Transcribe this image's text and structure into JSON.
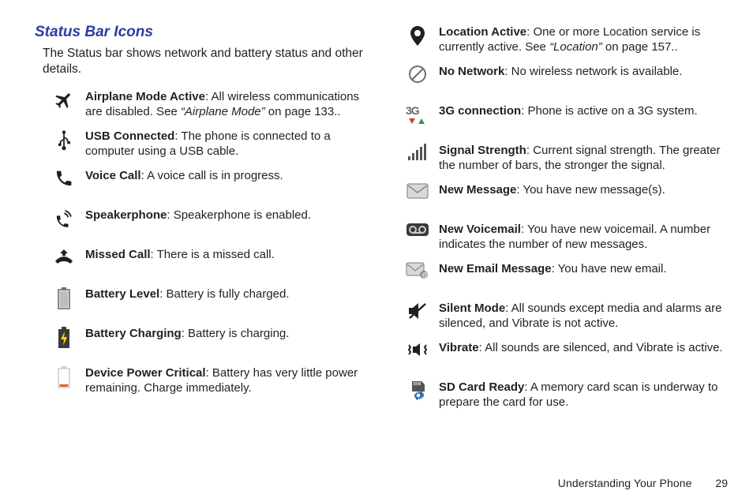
{
  "section_title": "Status Bar Icons",
  "intro": "The Status bar shows network and battery status and other details.",
  "left_items": [
    {
      "icon": "airplane",
      "title": "Airplane Mode Active",
      "text": ": All wireless communications are disabled. See ",
      "ref": "“Airplane Mode”",
      "after": " on page 133.."
    },
    {
      "icon": "usb",
      "title": "USB Connected",
      "text": ": The phone is connected to a computer using a USB cable.",
      "ref": "",
      "after": ""
    },
    {
      "icon": "phone",
      "title": "Voice Call",
      "text": ": A voice call is in progress.",
      "ref": "",
      "after": ""
    },
    {
      "icon": "speakerphone",
      "title": "Speakerphone",
      "text": ": Speakerphone is enabled.",
      "ref": "",
      "after": ""
    },
    {
      "icon": "missed",
      "title": "Missed Call",
      "text": ": There is a missed call.",
      "ref": "",
      "after": ""
    },
    {
      "icon": "battery-full",
      "title": "Battery Level",
      "text": ": Battery is fully charged.",
      "ref": "",
      "after": ""
    },
    {
      "icon": "battery-charge",
      "title": "Battery Charging",
      "text": ": Battery is charging.",
      "ref": "",
      "after": ""
    },
    {
      "icon": "battery-low",
      "title": "Device Power Critical",
      "text": ": Battery has very little power remaining. Charge immediately.",
      "ref": "",
      "after": ""
    }
  ],
  "right_items": [
    {
      "icon": "location",
      "title": "Location Active",
      "text": ": One or more Location service is currently active. See ",
      "ref": "“Location”",
      "after": " on page 157.."
    },
    {
      "icon": "nonet",
      "title": "No Network",
      "text": ": No wireless network is available.",
      "ref": "",
      "after": ""
    },
    {
      "icon": "3g",
      "title": "3G connection",
      "text": ": Phone is active on a 3G system.",
      "ref": "",
      "after": ""
    },
    {
      "icon": "signal",
      "title": "Signal Strength",
      "text": ": Current signal strength. The greater the number of bars, the stronger the signal.",
      "ref": "",
      "after": ""
    },
    {
      "icon": "message",
      "title": "New Message",
      "text": ": You have new message(s).",
      "ref": "",
      "after": ""
    },
    {
      "icon": "voicemail",
      "title": "New Voicemail",
      "text": ": You have new voicemail. A number indicates the number of new messages.",
      "ref": "",
      "after": ""
    },
    {
      "icon": "email",
      "title": "New Email Message",
      "text": ": You have new email.",
      "ref": "",
      "after": ""
    },
    {
      "icon": "silent",
      "title": "Silent Mode",
      "text": ": All sounds except media and alarms are silenced, and Vibrate is not active.",
      "ref": "",
      "after": ""
    },
    {
      "icon": "vibrate",
      "title": "Vibrate",
      "text": ": All sounds are silenced, and Vibrate is active.",
      "ref": "",
      "after": ""
    },
    {
      "icon": "sdcard",
      "title": "SD Card Ready",
      "text": ": A memory card scan is underway to prepare the card for use.",
      "ref": "",
      "after": ""
    }
  ],
  "footer_section": "Understanding Your Phone",
  "footer_page": "29"
}
